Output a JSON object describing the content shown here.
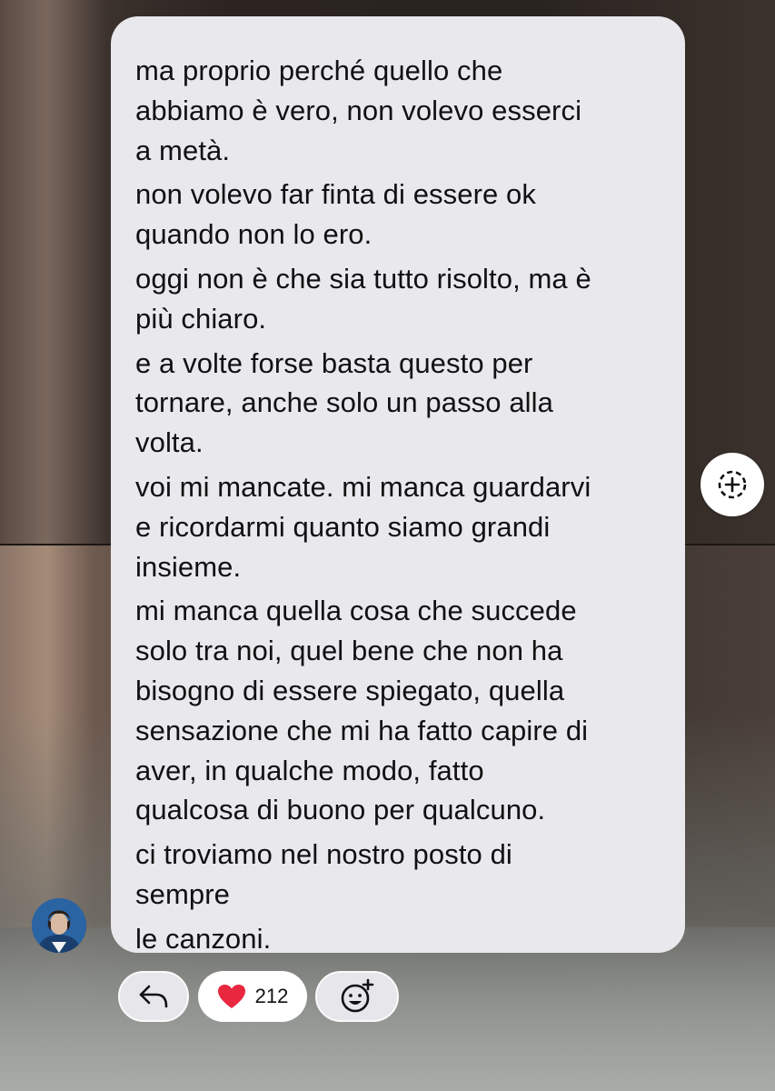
{
  "message": {
    "lines": [
      [
        "ma proprio perché quello che",
        "abbiamo è vero, non volevo esserci",
        "a metà."
      ],
      [
        "non volevo far finta di essere ok",
        "quando non lo ero."
      ],
      [
        "oggi non è che sia tutto risolto, ma è",
        "più chiaro."
      ],
      [
        "e a volte forse basta questo per",
        "tornare, anche solo un passo alla",
        "volta."
      ],
      [
        "voi mi mancate. mi manca guardarvi",
        "e ricordarmi quanto siamo grandi",
        "insieme."
      ],
      [
        "mi manca quella cosa che succede",
        "solo tra noi, quel bene che non ha",
        "bisogno di essere spiegato, quella",
        "sensazione che mi ha fatto capire di",
        "aver, in qualche modo, fatto",
        "qualcosa di buono per qualcuno."
      ],
      [
        "ci troviamo nel nostro posto di",
        "sempre"
      ],
      [
        "le canzoni."
      ]
    ]
  },
  "reactions": {
    "like_icon": "heart",
    "like_count": "212",
    "reply_icon": "reply-arrow-icon",
    "add_reaction_icon": "add-emoji-icon"
  },
  "share_icon": "add-to-story-icon",
  "colors": {
    "bubble": "#e9e8ec",
    "heart": "#e8283f"
  }
}
